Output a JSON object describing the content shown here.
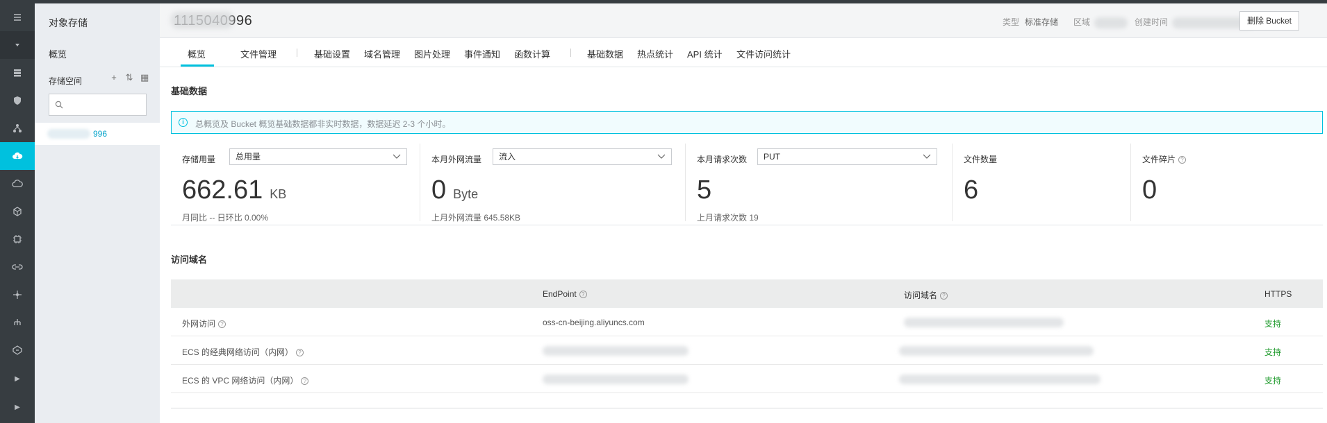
{
  "rail": {
    "icons": [
      "menu-icon",
      "chevron-down-icon",
      "storage-icon",
      "shield-icon",
      "network-icon",
      "cloud-storage-icon",
      "cloud-icon",
      "cube-icon",
      "chip-icon",
      "link-icon",
      "hub-icon",
      "tree-icon",
      "gateway-icon",
      "chevron-right-icon",
      "chevron-right-icon"
    ],
    "active_index": 4
  },
  "sidebar": {
    "title": "对象存储",
    "overview": "概览",
    "space_label": "存储空间",
    "search_placeholder": "",
    "bucket_name_suffix": "996"
  },
  "header": {
    "bucket_title": "1115040996",
    "type_label": "类型",
    "type_value": "标准存储",
    "region_label": "区域",
    "created_label": "创建时间",
    "delete_button": "删除 Bucket"
  },
  "tabs": [
    {
      "label": "概览",
      "active": true
    },
    {
      "label": "文件管理"
    },
    {
      "label": "基础设置"
    },
    {
      "label": "域名管理"
    },
    {
      "label": "图片处理"
    },
    {
      "label": "事件通知"
    },
    {
      "label": "函数计算"
    },
    {
      "label": "基础数据"
    },
    {
      "label": "热点统计"
    },
    {
      "label": "API 统计"
    },
    {
      "label": "文件访问统计"
    }
  ],
  "basic": {
    "title": "基础数据",
    "notice": "总概览及 Bucket 概览基础数据都非实时数据，数据延迟 2-3 个小时。"
  },
  "stats": [
    {
      "label": "存储用量",
      "select": "总用量",
      "value": "662.61",
      "unit": "KB",
      "sub": "月同比  --   日环比  0.00%"
    },
    {
      "label": "本月外网流量",
      "select": "流入",
      "value": "0",
      "unit": "Byte",
      "sub": "上月外网流量  645.58KB"
    },
    {
      "label": "本月请求次数",
      "select": "PUT",
      "value": "5",
      "unit": "",
      "sub": "上月请求次数  19"
    },
    {
      "label": "文件数量",
      "value": "6",
      "unit": "",
      "sub": ""
    },
    {
      "label": "文件碎片",
      "value": "0",
      "unit": "",
      "sub": ""
    }
  ],
  "domains": {
    "title": "访问域名",
    "headers": {
      "endpoint": "EndPoint",
      "domain": "访问域名",
      "https": "HTTPS"
    },
    "rows": [
      {
        "name": "外网访问",
        "endpoint": "oss-cn-beijing.aliyuncs.com",
        "https": "支持"
      },
      {
        "name": "ECS 的经典网络访问（内网）",
        "endpoint": "",
        "https": "支持"
      },
      {
        "name": "ECS 的 VPC 网络访问（内网）",
        "endpoint": "",
        "https": "支持"
      }
    ]
  },
  "colors": {
    "accent": "#00c1de",
    "rail": "#373d41",
    "support": "#1e9a2b"
  }
}
